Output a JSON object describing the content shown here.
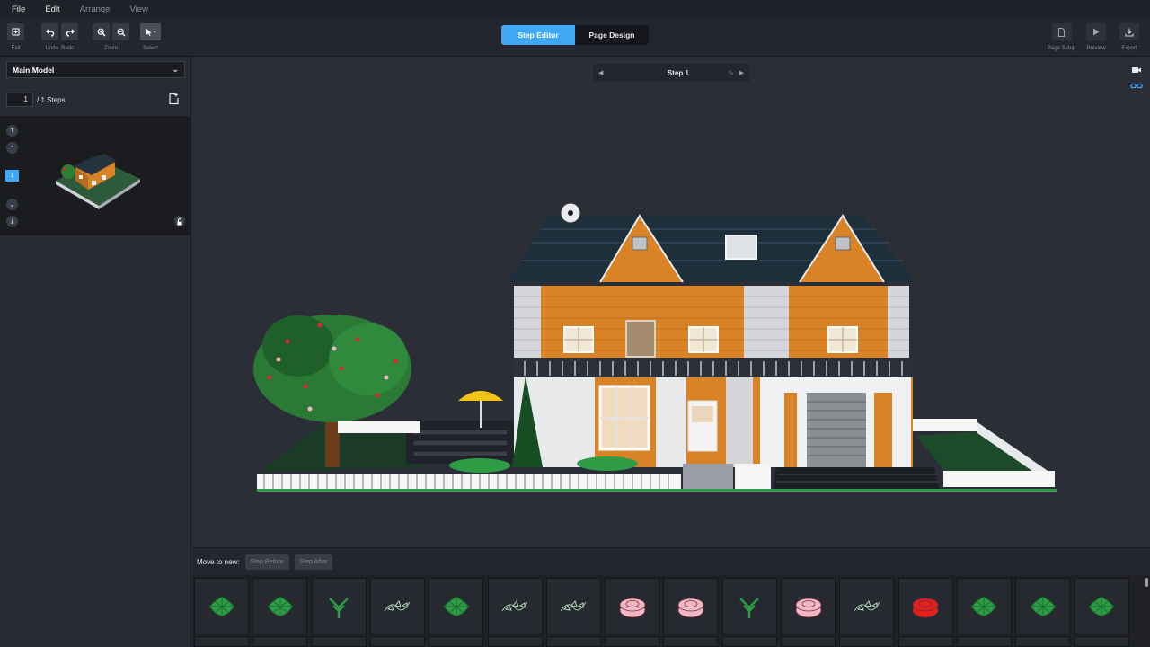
{
  "menu": {
    "items": [
      "File",
      "Edit",
      "Arrange",
      "View"
    ]
  },
  "toolbar": {
    "exit_label": "Exit",
    "undo_label": "Undo",
    "redo_label": "Redo",
    "zoom_label": "Zoom",
    "select_label": "Select",
    "tab_step_editor": "Step Editor",
    "tab_page_design": "Page Design",
    "page_setup_label": "Page Setup",
    "preview_label": "Preview",
    "export_label": "Export"
  },
  "sidebar": {
    "model_select": "Main Model",
    "step_input": "1",
    "steps_total": "/ 1 Steps",
    "current_step_badge": "1"
  },
  "viewport": {
    "step_title": "Step 1"
  },
  "bottom": {
    "move_to_new": "Move to new:",
    "step_before": "Step Before",
    "step_after": "Step After"
  },
  "parts": [
    {
      "kind": "green-plant-leaves",
      "color": "#2e9b45"
    },
    {
      "kind": "green-plant-leaves",
      "color": "#2e9b45"
    },
    {
      "kind": "green-stem",
      "color": "#2e9b45"
    },
    {
      "kind": "green-vine",
      "color": "#2e9b45"
    },
    {
      "kind": "green-plant-leaves",
      "color": "#2e9b45"
    },
    {
      "kind": "green-vine",
      "color": "#2e9b45"
    },
    {
      "kind": "green-vine",
      "color": "#2e9b45"
    },
    {
      "kind": "pink-round-plate",
      "color": "#f0b7c6"
    },
    {
      "kind": "pink-round-plate",
      "color": "#f0b7c6"
    },
    {
      "kind": "green-stem",
      "color": "#2e9b45"
    },
    {
      "kind": "pink-round-plate",
      "color": "#f0b7c6"
    },
    {
      "kind": "green-vine",
      "color": "#2e9b45"
    },
    {
      "kind": "red-round-plate",
      "color": "#e3201b"
    },
    {
      "kind": "green-plant-leaves",
      "color": "#2e9b45"
    },
    {
      "kind": "green-plant-leaves",
      "color": "#2e9b45"
    },
    {
      "kind": "green-plant-leaves",
      "color": "#2e9b45"
    }
  ],
  "colors": {
    "accent": "#3fa9f5",
    "house_orange": "#d98326",
    "roof": "#1e2f3c",
    "grass": "#1c4a2a"
  }
}
